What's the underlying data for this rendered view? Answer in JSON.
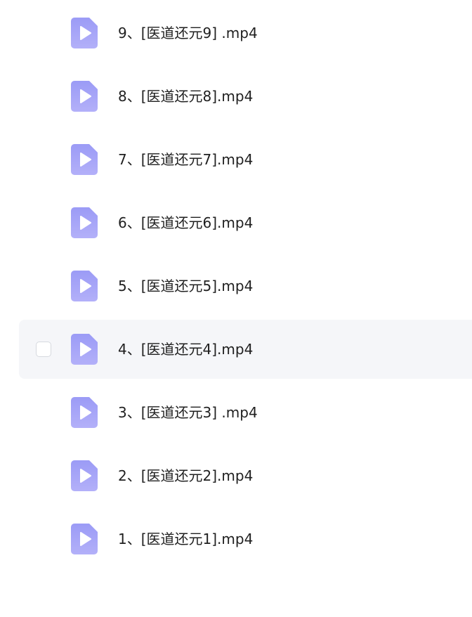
{
  "file_list": {
    "items": [
      {
        "name": "9、[医道还元9] .mp4",
        "icon": "video-file-icon",
        "hovered": false
      },
      {
        "name": "8、[医道还元8].mp4",
        "icon": "video-file-icon",
        "hovered": false
      },
      {
        "name": "7、[医道还元7].mp4",
        "icon": "video-file-icon",
        "hovered": false
      },
      {
        "name": "6、[医道还元6].mp4",
        "icon": "video-file-icon",
        "hovered": false
      },
      {
        "name": "5、[医道还元5].mp4",
        "icon": "video-file-icon",
        "hovered": false
      },
      {
        "name": "4、[医道还元4].mp4",
        "icon": "video-file-icon",
        "hovered": true
      },
      {
        "name": "3、[医道还元3] .mp4",
        "icon": "video-file-icon",
        "hovered": false
      },
      {
        "name": "2、[医道还元2].mp4",
        "icon": "video-file-icon",
        "hovered": false
      },
      {
        "name": "1、[医道还元1].mp4",
        "icon": "video-file-icon",
        "hovered": false
      }
    ]
  },
  "colors": {
    "icon_gradient_top": "#9b9bf6",
    "icon_gradient_bottom": "#b3b0f9",
    "hover_background": "#f5f6f9",
    "text": "#1f1f1f"
  }
}
